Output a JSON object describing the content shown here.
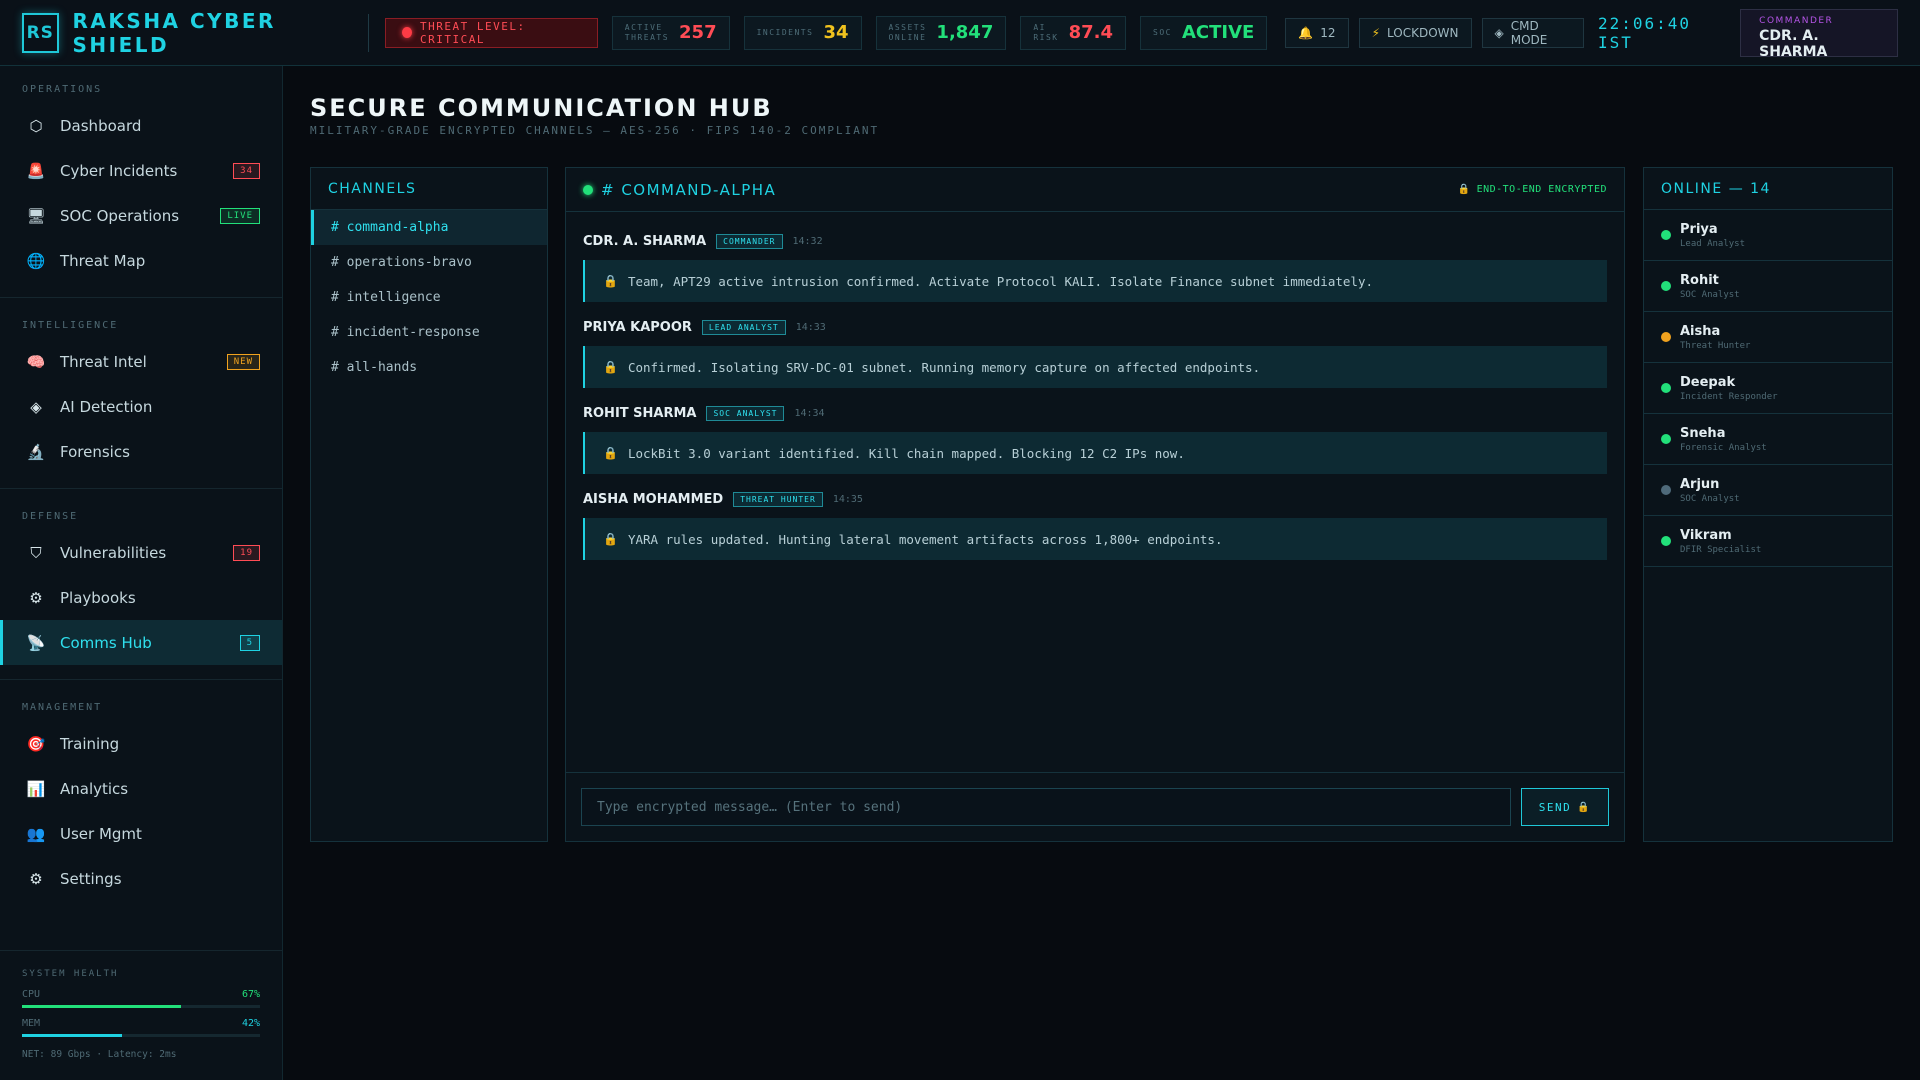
{
  "header": {
    "logo": "RS",
    "brand": "RAKSHA CYBER SHIELD",
    "threat_level": "THREAT LEVEL: CRITICAL",
    "stats": [
      {
        "label1": "ACTIVE",
        "label2": "THREATS",
        "value": "257",
        "color": "#ff4c55"
      },
      {
        "label1": "INCIDENTS",
        "label2": "",
        "value": "34",
        "color": "#f0c21e"
      },
      {
        "label1": "ASSETS",
        "label2": "ONLINE",
        "value": "1,847",
        "color": "#22e07a"
      },
      {
        "label1": "AI",
        "label2": "RISK",
        "value": "87.4",
        "color": "#ff4c55"
      },
      {
        "label1": "SOC",
        "label2": "",
        "value": "ACTIVE",
        "color": "#22e07a"
      }
    ],
    "alerts_count": "12",
    "lockdown_label": "LOCKDOWN",
    "cmd_mode_label": "CMD MODE",
    "clock": "22:06:40 IST",
    "commander_role": "COMMANDER",
    "commander_name": "CDR. A. SHARMA"
  },
  "sidebar": {
    "sections": [
      {
        "title": "OPERATIONS",
        "items": [
          {
            "label": "Dashboard",
            "icon": "hexagon-icon",
            "glyph": "⬡",
            "icon_color": "#d8e6ea"
          },
          {
            "label": "Cyber Incidents",
            "icon": "siren-icon",
            "glyph": "🚨",
            "badge": "34",
            "badge_color": "#ff4c55"
          },
          {
            "label": "SOC Operations",
            "icon": "server-icon",
            "glyph": "🖥",
            "badge": "LIVE",
            "badge_color": "#22e07a"
          },
          {
            "label": "Threat Map",
            "icon": "globe-icon",
            "glyph": "🌐"
          }
        ]
      },
      {
        "title": "INTELLIGENCE",
        "items": [
          {
            "label": "Threat Intel",
            "icon": "brain-icon",
            "glyph": "🧠",
            "badge": "NEW",
            "badge_color": "#f0a21e"
          },
          {
            "label": "AI Detection",
            "icon": "diamond-icon",
            "glyph": "◈",
            "icon_color": "#d8e6ea"
          },
          {
            "label": "Forensics",
            "icon": "microscope-icon",
            "glyph": "🔬"
          }
        ]
      },
      {
        "title": "DEFENSE",
        "items": [
          {
            "label": "Vulnerabilities",
            "icon": "shield-icon",
            "glyph": "⛉",
            "icon_color": "#d8e6ea",
            "badge": "19",
            "badge_color": "#ff4c55"
          },
          {
            "label": "Playbooks",
            "icon": "gear-icon",
            "glyph": "⚙",
            "icon_color": "#d8e6ea"
          },
          {
            "label": "Comms Hub",
            "icon": "satellite-icon",
            "glyph": "📡",
            "badge": "5",
            "badge_color": "#1fd2e2",
            "active": true
          }
        ]
      },
      {
        "title": "MANAGEMENT",
        "items": [
          {
            "label": "Training",
            "icon": "target-icon",
            "glyph": "🎯"
          },
          {
            "label": "Analytics",
            "icon": "chart-icon",
            "glyph": "📊"
          },
          {
            "label": "User Mgmt",
            "icon": "users-icon",
            "glyph": "👥"
          },
          {
            "label": "Settings",
            "icon": "gear-icon",
            "glyph": "⚙",
            "icon_color": "#d8e6ea"
          }
        ]
      }
    ],
    "health": {
      "title": "SYSTEM HEALTH",
      "cpu_label": "CPU",
      "cpu_value": "67%",
      "cpu_pct": 67,
      "mem_label": "MEM",
      "mem_value": "42%",
      "mem_pct": 42,
      "net": "NET: 89 Gbps · Latency: 2ms"
    }
  },
  "page": {
    "title": "SECURE COMMUNICATION HUB",
    "subtitle": "MILITARY-GRADE ENCRYPTED CHANNELS — AES-256 · FIPS 140-2 COMPLIANT"
  },
  "channels": {
    "title": "CHANNELS",
    "items": [
      "# command-alpha",
      "# operations-bravo",
      "# intelligence",
      "# incident-response",
      "# all-hands"
    ],
    "active_index": 0
  },
  "chat": {
    "channel_name": "# COMMAND-ALPHA",
    "encryption_label": "END-TO-END ENCRYPTED",
    "messages": [
      {
        "name": "CDR. A. SHARMA",
        "role": "COMMANDER",
        "time": "14:32",
        "text": "Team, APT29 active intrusion confirmed. Activate Protocol KALI. Isolate Finance subnet immediately."
      },
      {
        "name": "PRIYA KAPOOR",
        "role": "LEAD ANALYST",
        "time": "14:33",
        "text": "Confirmed. Isolating SRV-DC-01 subnet. Running memory capture on affected endpoints."
      },
      {
        "name": "ROHIT SHARMA",
        "role": "SOC ANALYST",
        "time": "14:34",
        "text": "LockBit 3.0 variant identified. Kill chain mapped. Blocking 12 C2 IPs now."
      },
      {
        "name": "AISHA MOHAMMED",
        "role": "THREAT HUNTER",
        "time": "14:35",
        "text": "YARA rules updated. Hunting lateral movement artifacts across 1,800+ endpoints."
      }
    ],
    "input_placeholder": "Type encrypted message… (Enter to send)",
    "input_value": "",
    "send_label": "SEND"
  },
  "online": {
    "title": "ONLINE — 14",
    "users": [
      {
        "name": "Priya",
        "role": "Lead Analyst",
        "status_color": "#22e07a"
      },
      {
        "name": "Rohit",
        "role": "SOC Analyst",
        "status_color": "#22e07a"
      },
      {
        "name": "Aisha",
        "role": "Threat Hunter",
        "status_color": "#f0a21e"
      },
      {
        "name": "Deepak",
        "role": "Incident Responder",
        "status_color": "#22e07a"
      },
      {
        "name": "Sneha",
        "role": "Forensic Analyst",
        "status_color": "#22e07a"
      },
      {
        "name": "Arjun",
        "role": "SOC Analyst",
        "status_color": "#4f6a7a"
      },
      {
        "name": "Vikram",
        "role": "DFIR Specialist",
        "status_color": "#22e07a"
      }
    ]
  },
  "colors": {
    "accent": "#1fd2e2",
    "danger": "#ff4c55",
    "success": "#22e07a",
    "warning": "#f0a21e"
  }
}
